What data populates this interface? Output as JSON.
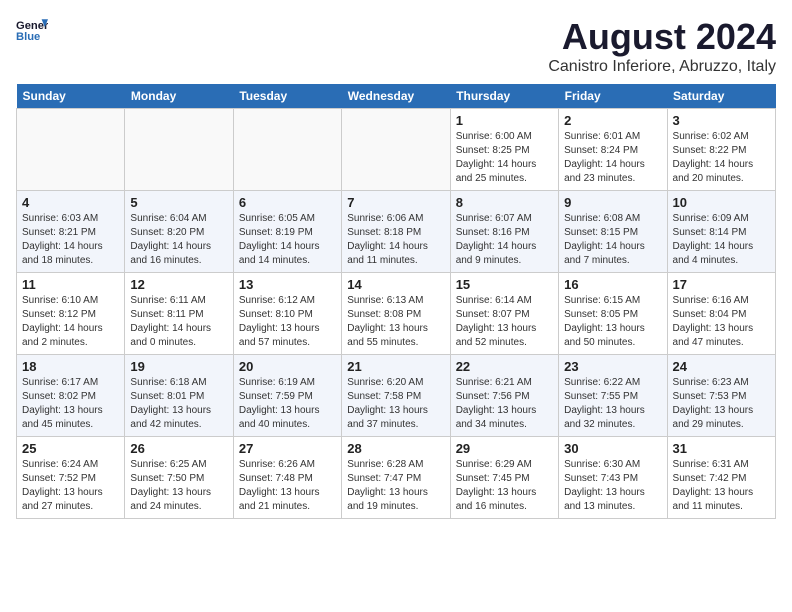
{
  "header": {
    "logo_line1": "General",
    "logo_line2": "Blue",
    "main_title": "August 2024",
    "subtitle": "Canistro Inferiore, Abruzzo, Italy"
  },
  "days_of_week": [
    "Sunday",
    "Monday",
    "Tuesday",
    "Wednesday",
    "Thursday",
    "Friday",
    "Saturday"
  ],
  "weeks": [
    [
      {
        "day": "",
        "info": ""
      },
      {
        "day": "",
        "info": ""
      },
      {
        "day": "",
        "info": ""
      },
      {
        "day": "",
        "info": ""
      },
      {
        "day": "1",
        "info": "Sunrise: 6:00 AM\nSunset: 8:25 PM\nDaylight: 14 hours and 25 minutes."
      },
      {
        "day": "2",
        "info": "Sunrise: 6:01 AM\nSunset: 8:24 PM\nDaylight: 14 hours and 23 minutes."
      },
      {
        "day": "3",
        "info": "Sunrise: 6:02 AM\nSunset: 8:22 PM\nDaylight: 14 hours and 20 minutes."
      }
    ],
    [
      {
        "day": "4",
        "info": "Sunrise: 6:03 AM\nSunset: 8:21 PM\nDaylight: 14 hours and 18 minutes."
      },
      {
        "day": "5",
        "info": "Sunrise: 6:04 AM\nSunset: 8:20 PM\nDaylight: 14 hours and 16 minutes."
      },
      {
        "day": "6",
        "info": "Sunrise: 6:05 AM\nSunset: 8:19 PM\nDaylight: 14 hours and 14 minutes."
      },
      {
        "day": "7",
        "info": "Sunrise: 6:06 AM\nSunset: 8:18 PM\nDaylight: 14 hours and 11 minutes."
      },
      {
        "day": "8",
        "info": "Sunrise: 6:07 AM\nSunset: 8:16 PM\nDaylight: 14 hours and 9 minutes."
      },
      {
        "day": "9",
        "info": "Sunrise: 6:08 AM\nSunset: 8:15 PM\nDaylight: 14 hours and 7 minutes."
      },
      {
        "day": "10",
        "info": "Sunrise: 6:09 AM\nSunset: 8:14 PM\nDaylight: 14 hours and 4 minutes."
      }
    ],
    [
      {
        "day": "11",
        "info": "Sunrise: 6:10 AM\nSunset: 8:12 PM\nDaylight: 14 hours and 2 minutes."
      },
      {
        "day": "12",
        "info": "Sunrise: 6:11 AM\nSunset: 8:11 PM\nDaylight: 14 hours and 0 minutes."
      },
      {
        "day": "13",
        "info": "Sunrise: 6:12 AM\nSunset: 8:10 PM\nDaylight: 13 hours and 57 minutes."
      },
      {
        "day": "14",
        "info": "Sunrise: 6:13 AM\nSunset: 8:08 PM\nDaylight: 13 hours and 55 minutes."
      },
      {
        "day": "15",
        "info": "Sunrise: 6:14 AM\nSunset: 8:07 PM\nDaylight: 13 hours and 52 minutes."
      },
      {
        "day": "16",
        "info": "Sunrise: 6:15 AM\nSunset: 8:05 PM\nDaylight: 13 hours and 50 minutes."
      },
      {
        "day": "17",
        "info": "Sunrise: 6:16 AM\nSunset: 8:04 PM\nDaylight: 13 hours and 47 minutes."
      }
    ],
    [
      {
        "day": "18",
        "info": "Sunrise: 6:17 AM\nSunset: 8:02 PM\nDaylight: 13 hours and 45 minutes."
      },
      {
        "day": "19",
        "info": "Sunrise: 6:18 AM\nSunset: 8:01 PM\nDaylight: 13 hours and 42 minutes."
      },
      {
        "day": "20",
        "info": "Sunrise: 6:19 AM\nSunset: 7:59 PM\nDaylight: 13 hours and 40 minutes."
      },
      {
        "day": "21",
        "info": "Sunrise: 6:20 AM\nSunset: 7:58 PM\nDaylight: 13 hours and 37 minutes."
      },
      {
        "day": "22",
        "info": "Sunrise: 6:21 AM\nSunset: 7:56 PM\nDaylight: 13 hours and 34 minutes."
      },
      {
        "day": "23",
        "info": "Sunrise: 6:22 AM\nSunset: 7:55 PM\nDaylight: 13 hours and 32 minutes."
      },
      {
        "day": "24",
        "info": "Sunrise: 6:23 AM\nSunset: 7:53 PM\nDaylight: 13 hours and 29 minutes."
      }
    ],
    [
      {
        "day": "25",
        "info": "Sunrise: 6:24 AM\nSunset: 7:52 PM\nDaylight: 13 hours and 27 minutes."
      },
      {
        "day": "26",
        "info": "Sunrise: 6:25 AM\nSunset: 7:50 PM\nDaylight: 13 hours and 24 minutes."
      },
      {
        "day": "27",
        "info": "Sunrise: 6:26 AM\nSunset: 7:48 PM\nDaylight: 13 hours and 21 minutes."
      },
      {
        "day": "28",
        "info": "Sunrise: 6:28 AM\nSunset: 7:47 PM\nDaylight: 13 hours and 19 minutes."
      },
      {
        "day": "29",
        "info": "Sunrise: 6:29 AM\nSunset: 7:45 PM\nDaylight: 13 hours and 16 minutes."
      },
      {
        "day": "30",
        "info": "Sunrise: 6:30 AM\nSunset: 7:43 PM\nDaylight: 13 hours and 13 minutes."
      },
      {
        "day": "31",
        "info": "Sunrise: 6:31 AM\nSunset: 7:42 PM\nDaylight: 13 hours and 11 minutes."
      }
    ]
  ]
}
